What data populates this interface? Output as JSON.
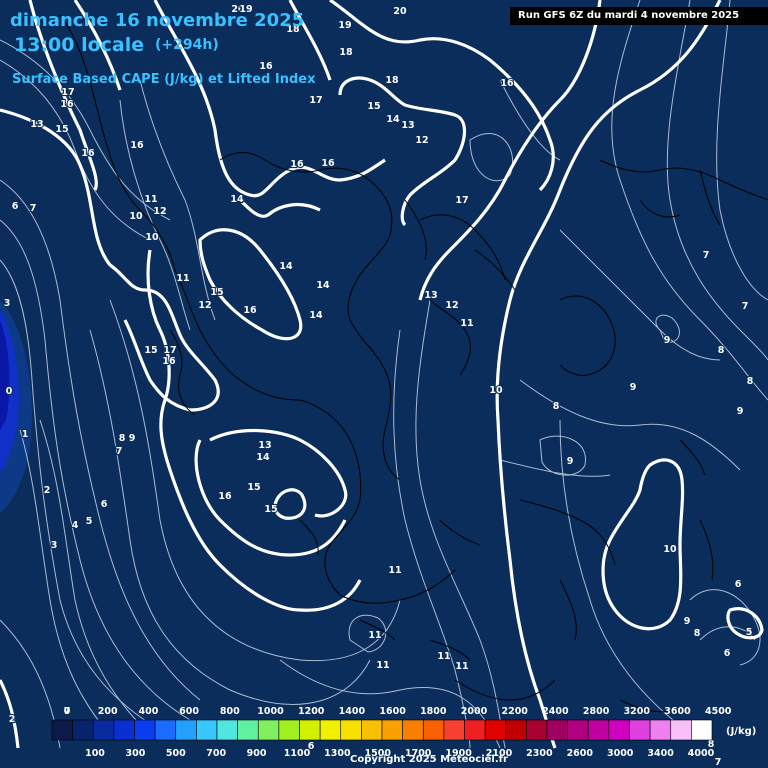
{
  "header": {
    "date": "dimanche 16 novembre 2025",
    "time": "13:00 locale",
    "lead": "(+294h)",
    "subtitle": "Surface Based CAPE (J/kg) et Lifted Index",
    "run": "Run GFS 6Z du mardi 4 novembre 2025"
  },
  "footer": {
    "copyright": "Copyright 2025 Meteociel.fr",
    "unit": "(J/kg)"
  },
  "colors": {
    "background": "#0a2d5c",
    "title": "#39c0ff",
    "contour_bold": "#ffffff",
    "contour_thin": "#c8d4e6",
    "coastline": "#000000"
  },
  "legend": {
    "top_labels": [
      "0",
      "200",
      "400",
      "600",
      "800",
      "1000",
      "1200",
      "1400",
      "1600",
      "1800",
      "2000",
      "2200",
      "2400",
      "2800",
      "3200",
      "3600",
      "4500"
    ],
    "bottom_labels": [
      "100",
      "300",
      "500",
      "700",
      "900",
      "1100",
      "1300",
      "1500",
      "1700",
      "1900",
      "2100",
      "2300",
      "2600",
      "3000",
      "3400",
      "4000"
    ],
    "colors": [
      "#0a1a4a",
      "#08236e",
      "#0a2aa0",
      "#0a2fd0",
      "#0a3cf0",
      "#1a6cff",
      "#23a0ff",
      "#38c8ff",
      "#50e6e0",
      "#60f0a0",
      "#80f060",
      "#a0f020",
      "#d0f000",
      "#f0f000",
      "#f8e000",
      "#f8c000",
      "#f8a000",
      "#f88000",
      "#f86000",
      "#f84030",
      "#f02020",
      "#e00000",
      "#c00000",
      "#a80030",
      "#a00060",
      "#b00080",
      "#c000a0",
      "#d000c0",
      "#e040e0",
      "#f080f0",
      "#f8c0f8",
      "#ffffff"
    ]
  },
  "lifted_index_labels": [
    {
      "t": "20"
    },
    {
      "t": "19"
    },
    {
      "t": "20"
    },
    {
      "t": "18"
    },
    {
      "t": "19"
    },
    {
      "t": "18"
    },
    {
      "t": "17"
    },
    {
      "t": "16"
    },
    {
      "t": "17"
    },
    {
      "t": "16"
    },
    {
      "t": "18"
    },
    {
      "t": "15"
    },
    {
      "t": "14"
    },
    {
      "t": "13"
    },
    {
      "t": "12"
    },
    {
      "t": "16"
    },
    {
      "t": "17"
    },
    {
      "t": "16"
    },
    {
      "t": "13"
    },
    {
      "t": "15"
    },
    {
      "t": "16"
    },
    {
      "t": "16"
    },
    {
      "t": "14"
    },
    {
      "t": "16"
    },
    {
      "t": "6"
    },
    {
      "t": "7"
    },
    {
      "t": "11"
    },
    {
      "t": "12"
    },
    {
      "t": "10"
    },
    {
      "t": "10"
    },
    {
      "t": "11"
    },
    {
      "t": "14"
    },
    {
      "t": "14"
    },
    {
      "t": "13"
    },
    {
      "t": "12"
    },
    {
      "t": "11"
    },
    {
      "t": "7"
    },
    {
      "t": "7"
    },
    {
      "t": "3"
    },
    {
      "t": "15"
    },
    {
      "t": "12"
    },
    {
      "t": "16"
    },
    {
      "t": "14"
    },
    {
      "t": "9"
    },
    {
      "t": "8"
    },
    {
      "t": "15"
    },
    {
      "t": "17"
    },
    {
      "t": "16"
    },
    {
      "t": "0"
    },
    {
      "t": "10"
    },
    {
      "t": "9"
    },
    {
      "t": "8"
    },
    {
      "t": "8"
    },
    {
      "t": "9"
    },
    {
      "t": "1"
    },
    {
      "t": "8"
    },
    {
      "t": "9"
    },
    {
      "t": "7"
    },
    {
      "t": "13"
    },
    {
      "t": "14"
    },
    {
      "t": "9"
    },
    {
      "t": "2"
    },
    {
      "t": "15"
    },
    {
      "t": "16"
    },
    {
      "t": "6"
    },
    {
      "t": "15"
    },
    {
      "t": "4"
    },
    {
      "t": "5"
    },
    {
      "t": "3"
    },
    {
      "t": "10"
    },
    {
      "t": "11"
    },
    {
      "t": "6"
    },
    {
      "t": "9"
    },
    {
      "t": "5"
    },
    {
      "t": "8"
    },
    {
      "t": "6"
    },
    {
      "t": "11"
    },
    {
      "t": "11"
    },
    {
      "t": "11"
    },
    {
      "t": "11"
    },
    {
      "t": "2"
    },
    {
      "t": "7"
    },
    {
      "t": "6"
    },
    {
      "t": "8"
    },
    {
      "t": "7"
    }
  ]
}
